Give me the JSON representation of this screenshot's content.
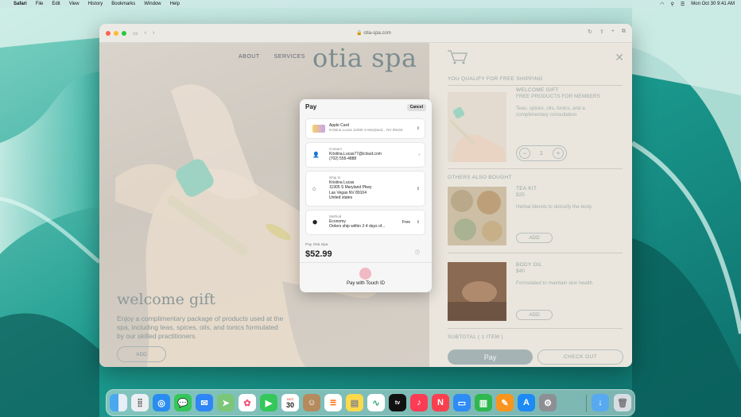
{
  "menubar": {
    "app": "Safari",
    "items": [
      "File",
      "Edit",
      "View",
      "History",
      "Bookmarks",
      "Window",
      "Help"
    ],
    "clock": "Mon Oct 30  9:41 AM"
  },
  "browser": {
    "url": "otia-spa.com"
  },
  "site": {
    "nav": [
      "ABOUT",
      "SERVICES"
    ],
    "logo": "otia spa",
    "hero_title": "welcome gift",
    "hero_text": "Enjoy a complimentary package of products used at the spa, including teas, spices, oils, and tonics formulated by our skilled practitioners.",
    "hero_add": "ADD"
  },
  "cart": {
    "shipping_note": "YOU QUALIFY FOR FREE SHIPPING",
    "welcome": {
      "name": "WELCOME GIFT",
      "sub": "FREE PRODUCTS FOR MEMBERS",
      "desc": "Teas, spices, oils, tonics, and a complimentary consultation",
      "qty": "1",
      "minus": "−",
      "plus": "+"
    },
    "others_title": "OTHERS ALSO BOUGHT",
    "tea": {
      "name": "TEA KIT",
      "price": "$25",
      "desc": "Herbal blends to detoxify the body",
      "add": "ADD"
    },
    "oil": {
      "name": "BODY OIL",
      "price": "$40",
      "desc": "Formulated to maintain skin health",
      "add": "ADD"
    },
    "subtotal": "SUBTOTAL ( 1 ITEM )",
    "applepay": " Pay",
    "checkout": "CHECK OUT"
  },
  "applepay_sheet": {
    "title": " Pay",
    "cancel": "Cancel",
    "card": {
      "name": "Apple Card",
      "detail": "Kristina Lucas 11905 S Maryland... NV 89104"
    },
    "contact": {
      "label": "Contact",
      "email": "Kristina.Lucas77@icloud.com",
      "phone": "(702) 555-4888"
    },
    "shipto": {
      "label": "Ship to",
      "name": "Kristina Lucas",
      "street": "11905 S Maryland Pkwy",
      "city": "Las Vegas NV 89104",
      "country": "United states"
    },
    "method": {
      "label": "Method",
      "name": "Economy",
      "detail": "Orders ship within 2-4 days of...",
      "price": "Free"
    },
    "pay_to": "Pay Otia Spa",
    "amount": "$52.99",
    "touch": "Pay with Touch ID"
  },
  "dock": {
    "calendar_month": "OCT",
    "calendar_day": "30",
    "apps": [
      "Finder",
      "Launchpad",
      "Safari",
      "Messages",
      "Mail",
      "Maps",
      "Photos",
      "FaceTime",
      "Calendar",
      "Contacts",
      "Reminders",
      "Notes",
      "Freeform",
      "Apple TV",
      "Music",
      "News",
      "Keynote",
      "Numbers",
      "Pages",
      "App Store",
      "System Settings",
      "Downloads",
      "Trash"
    ]
  },
  "colors": {
    "wallpaper": "#2fa79d",
    "accent_teal": "#8ecfc0",
    "dock_calendar_red": "#e84a3a"
  }
}
